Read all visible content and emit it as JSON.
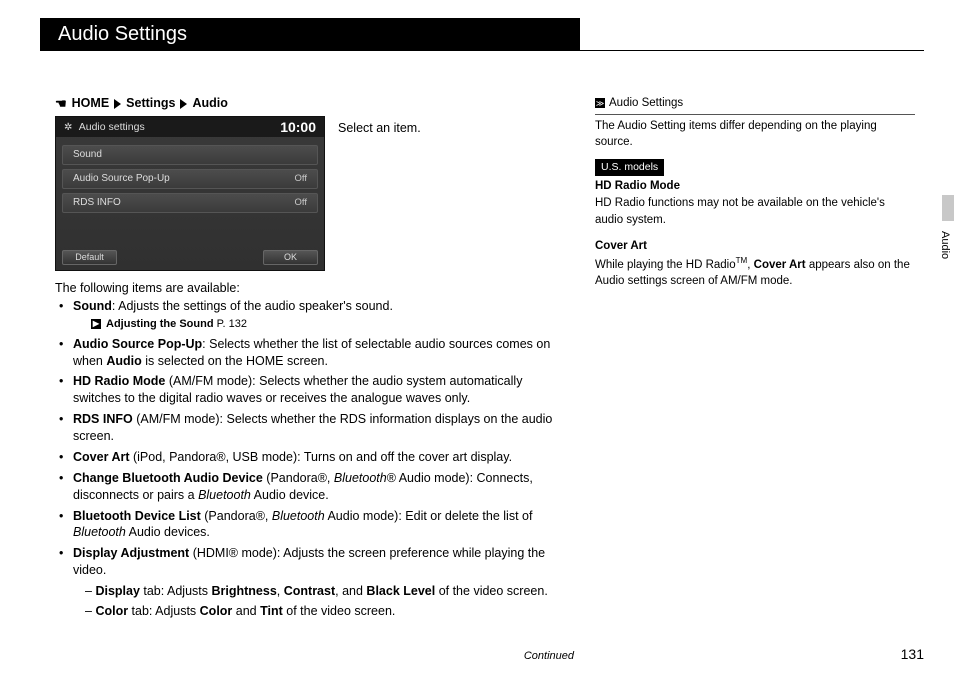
{
  "header": {
    "title": "Audio Settings"
  },
  "breadcrumb": {
    "home": "HOME",
    "l2": "Settings",
    "l3": "Audio"
  },
  "screenshot": {
    "title": "Audio settings",
    "clock": "10:00",
    "rows": [
      {
        "label": "Sound",
        "value": ""
      },
      {
        "label": "Audio Source Pop-Up",
        "value": "Off"
      },
      {
        "label": "RDS INFO",
        "value": "Off"
      }
    ],
    "btn_left": "Default",
    "btn_right": "OK"
  },
  "select_text": "Select an item.",
  "intro": "The following items are available:",
  "items": {
    "sound": {
      "term": "Sound",
      "desc": ": Adjusts the settings of the audio speaker's sound.",
      "xref": "Adjusting the Sound",
      "xref_page": "P. 132"
    },
    "popup": {
      "term": "Audio Source Pop-Up",
      "desc1": ": Selects whether the list of selectable audio sources comes on when ",
      "audio_bold": "Audio",
      "desc2": " is selected on the HOME screen."
    },
    "hd": {
      "term": "HD Radio Mode",
      "desc": " (AM/FM mode): Selects whether the audio system automatically switches to the digital radio waves or receives the analogue waves only."
    },
    "rds": {
      "term": "RDS INFO",
      "desc": " (AM/FM mode): Selects whether the RDS information displays on the audio screen."
    },
    "cover": {
      "term": "Cover Art",
      "desc": " (iPod, Pandora®, USB mode): Turns on and off the cover art display."
    },
    "cbad": {
      "term": "Change Bluetooth Audio Device",
      "desc1": " (Pandora®, ",
      "bt1": "Bluetooth",
      "desc2": "® Audio mode): Connects, disconnects or pairs a ",
      "bt2": "Bluetooth",
      "desc3": " Audio device."
    },
    "bdl": {
      "term": "Bluetooth Device List",
      "desc1": " (Pandora®, ",
      "bt1": "Bluetooth",
      "desc2": " Audio mode): Edit or delete the list of ",
      "bt2": "Bluetooth",
      "desc3": " Audio devices."
    },
    "disp": {
      "term": "Display Adjustment",
      "desc": " (HDMI® mode): Adjusts the screen preference while playing the video.",
      "sub1_pre": "– ",
      "sub1_term": "Display",
      "sub1_mid1": " tab: Adjusts ",
      "sub1_b1": "Brightness",
      "sub1_c1": ", ",
      "sub1_b2": "Contrast",
      "sub1_c2": ", and ",
      "sub1_b3": "Black Level",
      "sub1_post": " of the video screen.",
      "sub2_pre": "– ",
      "sub2_term": "Color",
      "sub2_mid1": " tab: Adjusts ",
      "sub2_b1": "Color",
      "sub2_c1": " and ",
      "sub2_b2": "Tint",
      "sub2_post": " of the video screen."
    }
  },
  "rcol": {
    "hdr": "Audio Settings",
    "p1": "The Audio Setting items differ depending on the playing source.",
    "badge": "U.S. models",
    "hd_hdr": "HD Radio Mode",
    "hd_txt": "HD Radio functions may not be available on the vehicle's audio system.",
    "ca_hdr": "Cover Art",
    "ca_1": "While playing the HD Radio",
    "ca_tm": "TM",
    "ca_2": ", ",
    "ca_bold": "Cover Art",
    "ca_3": " appears also on the Audio settings screen of AM/FM mode."
  },
  "footer": {
    "continued": "Continued",
    "page": "131"
  },
  "side_tab": "Audio"
}
